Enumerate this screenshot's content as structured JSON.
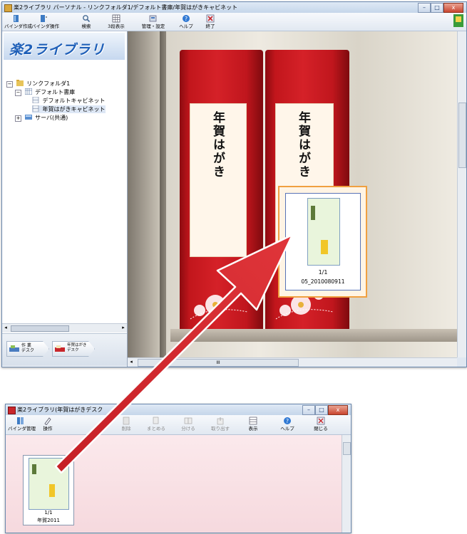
{
  "top_window": {
    "title": "楽2ライブラリ パーソナル - リンクフォルダ1/デフォルト書庫/年賀はがきキャビネット",
    "toolbar": [
      {
        "label": "バインダ作成",
        "icon": "binder-create-icon"
      },
      {
        "label": "バインダ操作",
        "icon": "binder-ops-icon"
      },
      {
        "label": "検索",
        "icon": "search-icon"
      },
      {
        "label": "3段表示",
        "icon": "grid-icon"
      },
      {
        "label": "管理・設定",
        "icon": "settings-icon"
      },
      {
        "label": "ヘルプ",
        "icon": "help-icon"
      },
      {
        "label": "終了",
        "icon": "exit-icon"
      }
    ],
    "logo_text": "楽2ライブラリ",
    "tree": {
      "root": "リンクフォルダ1",
      "library": "デフォルト書庫",
      "cabinet_default": "デフォルトキャビネット",
      "cabinet_nenga": "年賀はがきキャビネット",
      "server": "サーバ(共通)"
    },
    "desk_tabs": [
      {
        "label1": "作 業",
        "label2": "デスク"
      },
      {
        "label1": "年賀はがき",
        "label2": "デスク"
      }
    ],
    "binder_spines": [
      "年賀はがき",
      "年賀はがき"
    ],
    "thumbnail": {
      "page": "1/1",
      "filename": "05_2010080911"
    },
    "scroll_label": "III"
  },
  "bottom_window": {
    "title": "楽2ライブラリ(年賀はがきデスク",
    "toolbar": [
      {
        "label": "バインダ管理",
        "icon": "binder-manage-icon"
      },
      {
        "label": "操作",
        "icon": "operate-icon"
      },
      {
        "label": "削除",
        "icon": "delete-icon"
      },
      {
        "label": "まとめる",
        "icon": "merge-icon"
      },
      {
        "label": "分ける",
        "icon": "split-icon"
      },
      {
        "label": "取り出す",
        "icon": "extract-icon"
      },
      {
        "label": "表示",
        "icon": "view-icon"
      },
      {
        "label": "ヘルプ",
        "icon": "help-icon"
      },
      {
        "label": "閉じる",
        "icon": "close-window-icon"
      }
    ],
    "thumbnail": {
      "page": "1/1",
      "filename": "年賀2011"
    }
  },
  "colors": {
    "arrow": "#d4252a",
    "binder": "#c9151c",
    "desk_bg": "#fbe6ea",
    "accent_orange": "#f0a040"
  }
}
